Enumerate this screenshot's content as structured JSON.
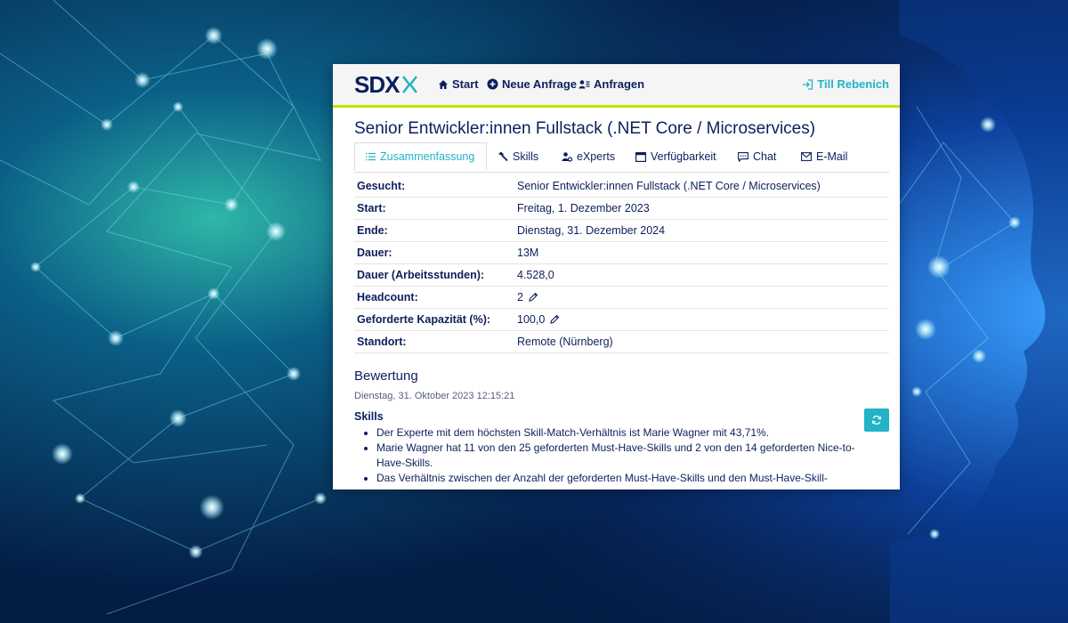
{
  "nav": {
    "logo_text": "SDX",
    "items": [
      {
        "label": "Start",
        "icon": "home-icon"
      },
      {
        "label": "Neue Anfrage",
        "icon": "plus-circle-icon"
      },
      {
        "label": "Anfragen",
        "icon": "users-list-icon"
      }
    ],
    "user_label": "Till Rebenich"
  },
  "page": {
    "title": "Senior Entwickler:innen Fullstack (.NET Core / Microservices)"
  },
  "tabs": [
    {
      "label": "Zusammenfassung",
      "icon": "list-icon",
      "active": true
    },
    {
      "label": "Skills",
      "icon": "hammer-icon",
      "active": false
    },
    {
      "label": "eXperts",
      "icon": "user-gear-icon",
      "active": false
    },
    {
      "label": "Verfügbarkeit",
      "icon": "calendar-window-icon",
      "active": false
    },
    {
      "label": "Chat",
      "icon": "chat-icon",
      "active": false
    },
    {
      "label": "E-Mail",
      "icon": "envelope-icon",
      "active": false
    }
  ],
  "details": [
    {
      "label": "Gesucht:",
      "value": "Senior Entwickler:innen Fullstack (.NET Core / Microservices)",
      "editable": false
    },
    {
      "label": "Start:",
      "value": "Freitag, 1. Dezember 2023",
      "editable": false
    },
    {
      "label": "Ende:",
      "value": "Dienstag, 31. Dezember 2024",
      "editable": false
    },
    {
      "label": "Dauer:",
      "value": "13M",
      "editable": false
    },
    {
      "label": "Dauer (Arbeitsstunden):",
      "value": "4.528,0",
      "editable": false
    },
    {
      "label": "Headcount:",
      "value": "2",
      "editable": true
    },
    {
      "label": "Geforderte Kapazität (%):",
      "value": "100,0",
      "editable": true
    },
    {
      "label": "Standort:",
      "value": "Remote (Nürnberg)",
      "editable": false
    }
  ],
  "bewertung": {
    "title": "Bewertung",
    "timestamp": "Dienstag, 31. Oktober 2023 12:15:21",
    "skills_heading": "Skills",
    "bullets": [
      "Der Experte mit dem höchsten Skill-Match-Verhältnis ist Marie Wagner mit 43,71%.",
      "Marie Wagner hat 11 von den 25 geforderten Must-Have-Skills und 2 von den 14 geforderten Nice-to-Have-Skills.",
      "Das Verhältnis zwischen der Anzahl der geforderten Must-Have-Skills und den Must-Have-Skill-"
    ]
  },
  "colors": {
    "brand_navy": "#0d1f5c",
    "accent_teal": "#22b3c6",
    "accent_lime": "#c8e000",
    "background_blue": "#062a55"
  }
}
